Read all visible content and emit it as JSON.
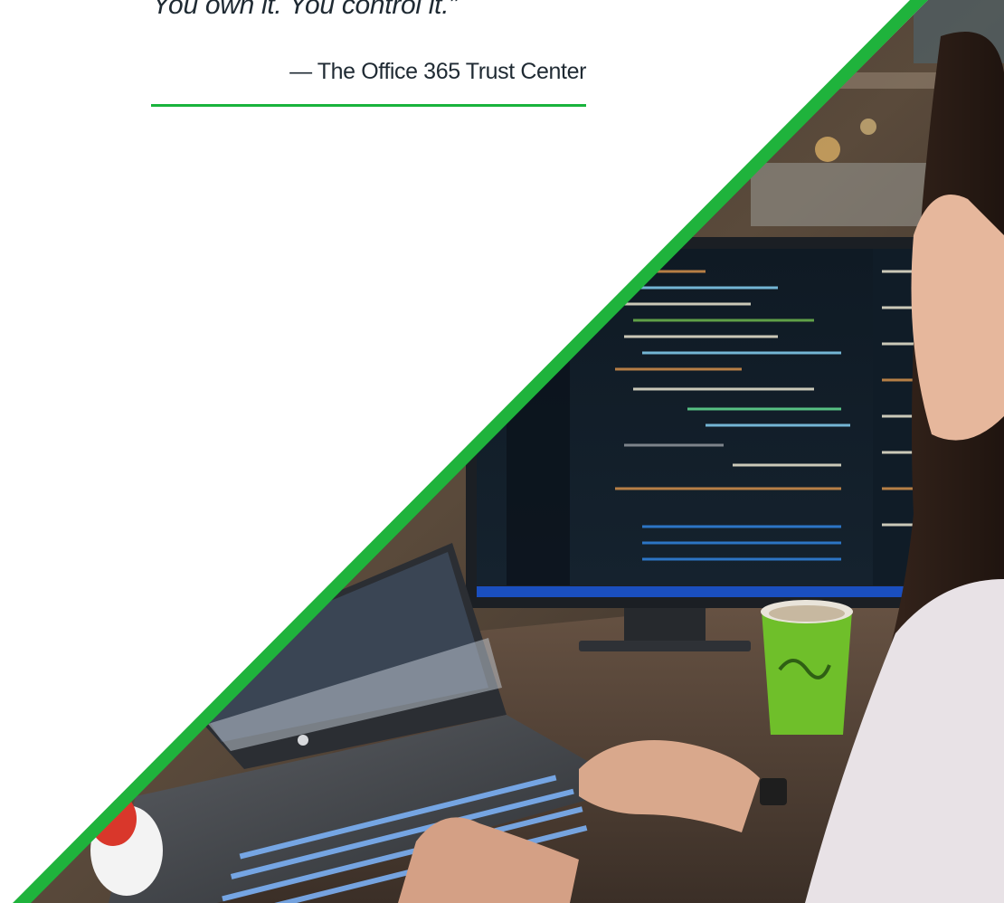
{
  "quote": {
    "text": "You own it. You control it.”",
    "attribution": "— The Office 365 Trust Center"
  },
  "colors": {
    "accent_green": "#1fb33c",
    "background": "#ffffff",
    "text": "#1f2a33"
  },
  "photo": {
    "icon": "developer-workspace-photo"
  }
}
